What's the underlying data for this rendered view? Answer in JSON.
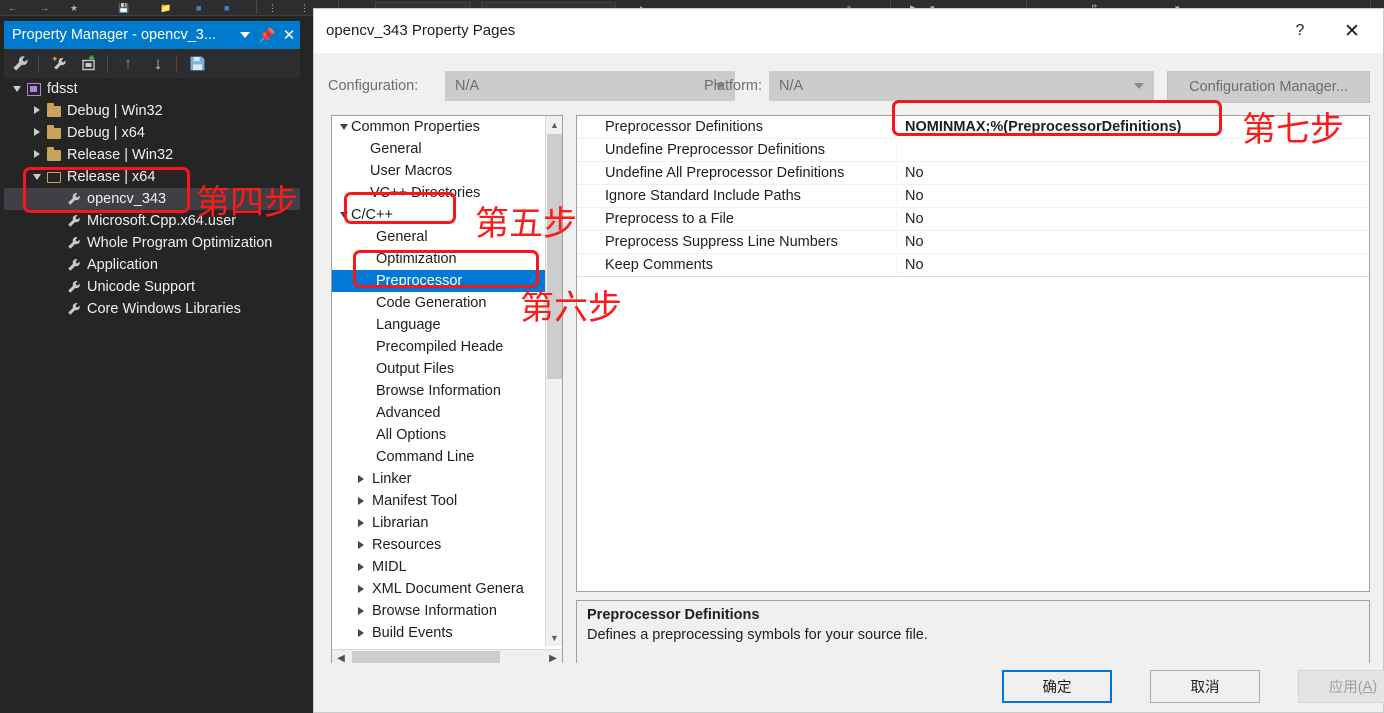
{
  "property_manager": {
    "title": "Property Manager - opencv_3...",
    "titlebar_buttons": [
      {
        "name": "dropdown",
        "icon": "chevron-down-icon"
      },
      {
        "name": "pin",
        "icon": "pin-icon",
        "glyph": "⚐"
      },
      {
        "name": "close",
        "icon": "close-icon",
        "glyph": "✕"
      }
    ],
    "toolbar": [
      {
        "name": "properties",
        "icon": "wrench-icon"
      },
      {
        "name": "add-new-project-property-sheet",
        "icon": "wrench-sparkle-icon"
      },
      {
        "name": "add-existing-property-sheet",
        "icon": "add-sheet-icon"
      },
      {
        "name": "move-up",
        "icon": "arrow-up-icon",
        "glyph": "↑"
      },
      {
        "name": "move-down",
        "icon": "arrow-down-icon",
        "glyph": "↓"
      },
      {
        "name": "save",
        "icon": "save-disk-icon"
      }
    ],
    "tree": [
      {
        "label": "fdsst",
        "indent": 0,
        "icon": "project-icon",
        "state": "expanded",
        "selected": false
      },
      {
        "label": "Debug | Win32",
        "indent": 1,
        "icon": "folder-icon",
        "state": "collapsed",
        "selected": false
      },
      {
        "label": "Debug | x64",
        "indent": 1,
        "icon": "folder-icon",
        "state": "collapsed",
        "selected": false
      },
      {
        "label": "Release | Win32",
        "indent": 1,
        "icon": "folder-icon",
        "state": "collapsed",
        "selected": false
      },
      {
        "label": "Release | x64",
        "indent": 1,
        "icon": "folder-open-icon",
        "state": "expanded",
        "selected": false
      },
      {
        "label": "opencv_343",
        "indent": 2,
        "icon": "wrench-icon",
        "state": "leaf",
        "selected": true
      },
      {
        "label": "Microsoft.Cpp.x64.user",
        "indent": 2,
        "icon": "wrench-icon",
        "state": "leaf",
        "selected": false
      },
      {
        "label": "Whole Program Optimization",
        "indent": 2,
        "icon": "wrench-icon",
        "state": "leaf",
        "selected": false
      },
      {
        "label": "Application",
        "indent": 2,
        "icon": "wrench-icon",
        "state": "leaf",
        "selected": false
      },
      {
        "label": "Unicode Support",
        "indent": 2,
        "icon": "wrench-icon",
        "state": "leaf",
        "selected": false
      },
      {
        "label": "Core Windows Libraries",
        "indent": 2,
        "icon": "wrench-icon",
        "state": "leaf",
        "selected": false
      }
    ]
  },
  "dialog": {
    "title": "opencv_343 Property Pages",
    "help_glyph": "?",
    "close_glyph": "✕",
    "configuration": {
      "label": "Configuration:",
      "value": "N/A",
      "platform_label": "Platform:",
      "platform_value": "N/A",
      "manager_button": "Configuration Manager..."
    },
    "tree": [
      {
        "label": "Common Properties",
        "indent": 0,
        "state": "expanded",
        "selected": false
      },
      {
        "label": "General",
        "indent": 1,
        "state": "leaf",
        "selected": false
      },
      {
        "label": "User Macros",
        "indent": 1,
        "state": "leaf",
        "selected": false
      },
      {
        "label": "VC++ Directories",
        "indent": 1,
        "state": "leaf",
        "selected": false
      },
      {
        "label": "C/C++",
        "indent": 1,
        "state": "expanded",
        "selected": false
      },
      {
        "label": "General",
        "indent": 2,
        "state": "leaf",
        "selected": false
      },
      {
        "label": "Optimization",
        "indent": 2,
        "state": "leaf",
        "selected": false
      },
      {
        "label": "Preprocessor",
        "indent": 2,
        "state": "leaf",
        "selected": true
      },
      {
        "label": "Code Generation",
        "indent": 2,
        "state": "leaf",
        "selected": false
      },
      {
        "label": "Language",
        "indent": 2,
        "state": "leaf",
        "selected": false
      },
      {
        "label": "Precompiled Heade",
        "indent": 2,
        "state": "leaf",
        "selected": false
      },
      {
        "label": "Output Files",
        "indent": 2,
        "state": "leaf",
        "selected": false
      },
      {
        "label": "Browse Information",
        "indent": 2,
        "state": "leaf",
        "selected": false
      },
      {
        "label": "Advanced",
        "indent": 2,
        "state": "leaf",
        "selected": false
      },
      {
        "label": "All Options",
        "indent": 2,
        "state": "leaf",
        "selected": false
      },
      {
        "label": "Command Line",
        "indent": 2,
        "state": "leaf",
        "selected": false
      },
      {
        "label": "Linker",
        "indent": 1,
        "state": "collapsed",
        "selected": false
      },
      {
        "label": "Manifest Tool",
        "indent": 1,
        "state": "collapsed",
        "selected": false
      },
      {
        "label": "Librarian",
        "indent": 1,
        "state": "collapsed",
        "selected": false
      },
      {
        "label": "Resources",
        "indent": 1,
        "state": "collapsed",
        "selected": false
      },
      {
        "label": "MIDL",
        "indent": 1,
        "state": "collapsed",
        "selected": false
      },
      {
        "label": "XML Document Genera",
        "indent": 1,
        "state": "collapsed",
        "selected": false
      },
      {
        "label": "Browse Information",
        "indent": 1,
        "state": "collapsed",
        "selected": false
      },
      {
        "label": "Build Events",
        "indent": 1,
        "state": "collapsed",
        "selected": false
      }
    ],
    "grid": [
      {
        "name": "Preprocessor Definitions",
        "value": "NOMINMAX;%(PreprocessorDefinitions)",
        "bold": true
      },
      {
        "name": "Undefine Preprocessor Definitions",
        "value": "",
        "bold": false
      },
      {
        "name": "Undefine All Preprocessor Definitions",
        "value": "No",
        "bold": false
      },
      {
        "name": "Ignore Standard Include Paths",
        "value": "No",
        "bold": false
      },
      {
        "name": "Preprocess to a File",
        "value": "No",
        "bold": false
      },
      {
        "name": "Preprocess Suppress Line Numbers",
        "value": "No",
        "bold": false
      },
      {
        "name": "Keep Comments",
        "value": "No",
        "bold": false
      }
    ],
    "description": {
      "title": "Preprocessor Definitions",
      "text": "Defines a preprocessing symbols for your source file."
    },
    "footer": {
      "ok": "确定",
      "cancel": "取消",
      "apply_prefix": "应用(",
      "apply_key": "A",
      "apply_suffix": ")"
    }
  },
  "annotations": [
    {
      "id": "step4",
      "text": "第四步"
    },
    {
      "id": "step5",
      "text": "第五步"
    },
    {
      "id": "step6",
      "text": "第六步"
    },
    {
      "id": "step7",
      "text": "第七步"
    }
  ],
  "colors": {
    "accent_blue": "#007acc",
    "selection_blue": "#0078d7",
    "annotation_red": "#f61818",
    "dark_bg": "#252526"
  }
}
